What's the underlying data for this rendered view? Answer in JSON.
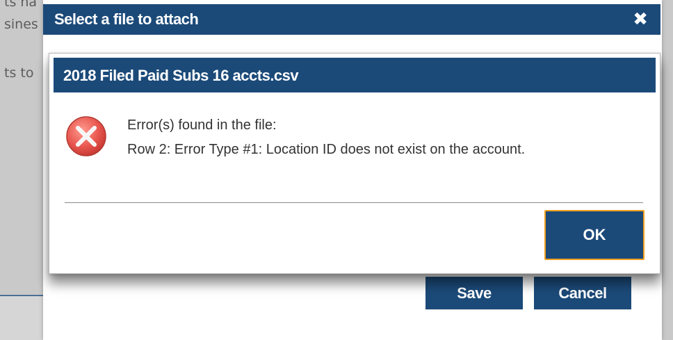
{
  "background": {
    "fragments": [
      "ts ha",
      "sines",
      "ts to"
    ]
  },
  "outer_dialog": {
    "title": "Select a file to attach",
    "close_glyph": "✖",
    "buttons": {
      "save": "Save",
      "cancel": "Cancel"
    }
  },
  "error_dialog": {
    "title": "2018 Filed Paid Subs 16 accts.csv",
    "icon": "error-icon",
    "message_heading": "Error(s) found in the file:",
    "message_detail": "Row 2: Error Type #1: Location ID does not exist on the account.",
    "ok_label": "OK"
  },
  "colors": {
    "header_blue": "#1b4a79",
    "focus_ring": "#f0a020",
    "error_red": "#e8574f"
  }
}
